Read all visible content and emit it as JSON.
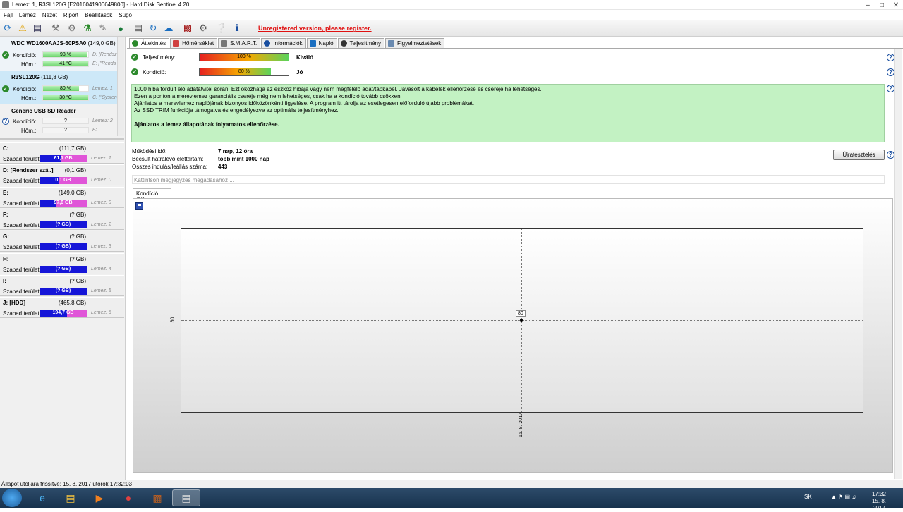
{
  "window": {
    "title": "Lemez: 1, R3SL120G [E2016041900649800]  -  Hard Disk Sentinel 4.20"
  },
  "menu": [
    "Fájl",
    "Lemez",
    "Nézet",
    "Riport",
    "Beállítások",
    "Súgó"
  ],
  "toolbar": {
    "unregistered": "Unregistered version, please register."
  },
  "disks": [
    {
      "name": "WDC WD1600AAJS-60PSA0",
      "size": "(149,0 GB)",
      "cond_label": "Kondíció:",
      "cond": "98 %",
      "cond_pct": 98,
      "temp_label": "Hőm.:",
      "temp": "41 °C",
      "temp_pct": 41,
      "r1": "D: [Rendsz",
      "r2": "E: [\"Rends"
    },
    {
      "name": "R3SL120G",
      "size": "(111,8 GB)",
      "cond_label": "Kondíció:",
      "cond": "80 %",
      "cond_pct": 80,
      "temp_label": "Hőm.:",
      "temp": "30 °C",
      "temp_pct": 30,
      "r1": "Lemez: 1",
      "r2": "C: [\"Systen"
    },
    {
      "name": "Generic USB SD Reader",
      "size": "",
      "cond_label": "Kondíció:",
      "cond": "?",
      "cond_pct": 0,
      "temp_label": "Hőm.:",
      "temp": "?",
      "temp_pct": 0,
      "r1": "Lemez: 2",
      "r2": "F:"
    }
  ],
  "partitions": [
    {
      "name": "C:",
      "size": "(111,7 GB)",
      "free_label": "Szabad terület",
      "free": "61,1 GB",
      "free_pct": 55,
      "disk": "Lemez: 1"
    },
    {
      "name": "D: [Rendszer szá..]",
      "size": "(0,1 GB)",
      "free_label": "Szabad terület",
      "free": "0,1 GB",
      "free_pct": 60,
      "disk": "Lemez: 0"
    },
    {
      "name": "E:",
      "size": "(149,0 GB)",
      "free_label": "Szabad terület",
      "free": "97,6 GB",
      "free_pct": 65,
      "disk": "Lemez: 0"
    },
    {
      "name": "F:",
      "size": "(? GB)",
      "free_label": "Szabad terület",
      "free": "(? GB)",
      "free_pct": 0,
      "disk": "Lemez: 2"
    },
    {
      "name": "G:",
      "size": "(? GB)",
      "free_label": "Szabad terület",
      "free": "(? GB)",
      "free_pct": 0,
      "disk": "Lemez: 3"
    },
    {
      "name": "H:",
      "size": "(? GB)",
      "free_label": "Szabad terület",
      "free": "(? GB)",
      "free_pct": 0,
      "disk": "Lemez: 4"
    },
    {
      "name": "I:",
      "size": "(? GB)",
      "free_label": "Szabad terület",
      "free": "(? GB)",
      "free_pct": 0,
      "disk": "Lemez: 5"
    },
    {
      "name": "J: [HDD]",
      "size": "(465,8 GB)",
      "free_label": "Szabad terület",
      "free": "194,7 GB",
      "free_pct": 42,
      "disk": "Lemez: 6"
    }
  ],
  "tabs": [
    "Áttekintés",
    "Hőmérséklet",
    "S.M.A.R.T.",
    "Információk",
    "Napló",
    "Teljesítmény",
    "Figyelmeztetések"
  ],
  "metrics": {
    "perf_label": "Teljesítmény:",
    "perf_value": "100 %",
    "perf_pct": 100,
    "perf_text": "Kiváló",
    "cond_label": "Kondíció:",
    "cond_value": "80 %",
    "cond_pct": 80,
    "cond_text": "Jó"
  },
  "message": [
    "1000 hiba fordult elő adatátvitel során. Ezt okozhatja az eszköz hibája vagy nem megfelelő adat/tápkábel. Javasolt a kábelek ellenőrzése és cseréje ha lehetséges.",
    "Ezen a ponton a merevlemez garanciális cseréje még nem lehetséges, csak ha a kondíció tovább csökken.",
    "Ajánlatos a merevlemez naplójának bizonyos időközönkénti figyelése. A program itt tárolja az esetlegesen előforduló újabb problémákat.",
    "Az SSD TRIM funkciója támogatva és engedélyezve az optimális teljesítményhez."
  ],
  "message_bold": "Ajánlatos a lemez állapotának folyamatos ellenőrzése.",
  "info": {
    "uptime_label": "Működési idő:",
    "uptime": "7 nap, 12 óra",
    "life_label": "Becsült hátralévő élettartam:",
    "life": "több mint 1000 nap",
    "starts_label": "Összes indulás/leállás száma:",
    "starts": "443"
  },
  "retest_label": "Újratesztelés",
  "note_placeholder": "Kattintson megjegyzés megadásához ...",
  "chart_tab": "Kondíció  (%)",
  "chart_data": {
    "type": "line",
    "x": [
      "15. 8. 2017"
    ],
    "series": [
      {
        "values": [
          80
        ]
      }
    ],
    "ytick": "80",
    "point_label": "80"
  },
  "status": "Állapot utoljára frissítve: 15. 8. 2017 utorok 17:32:03",
  "taskbar": {
    "lang": "SK",
    "time": "17:32",
    "date": "15. 8. 2017"
  }
}
